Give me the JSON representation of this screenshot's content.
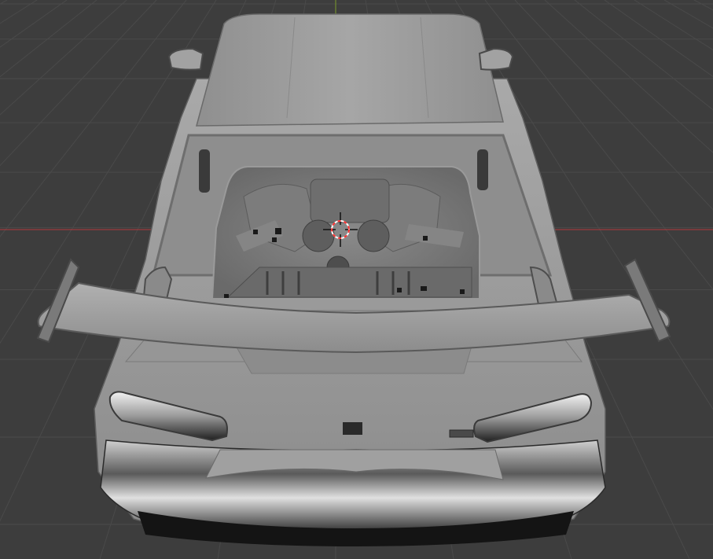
{
  "app": "3D viewport",
  "viewport": {
    "background_color": "#3d3d3d",
    "grid_color": "#4a4a4a",
    "x_axis_color": "#b3383c",
    "y_axis_color": "#7a9a2a"
  },
  "scene": {
    "object": "car-model",
    "shading": "solid",
    "parts": [
      "roof",
      "rear-window",
      "engine-bay",
      "rear-spoiler",
      "tail-lights",
      "rear-bumper",
      "side-mirrors"
    ]
  },
  "cursor_3d": {
    "icon": "3d-cursor-icon",
    "ring_colors": [
      "#ff3030",
      "#ffffff"
    ]
  }
}
